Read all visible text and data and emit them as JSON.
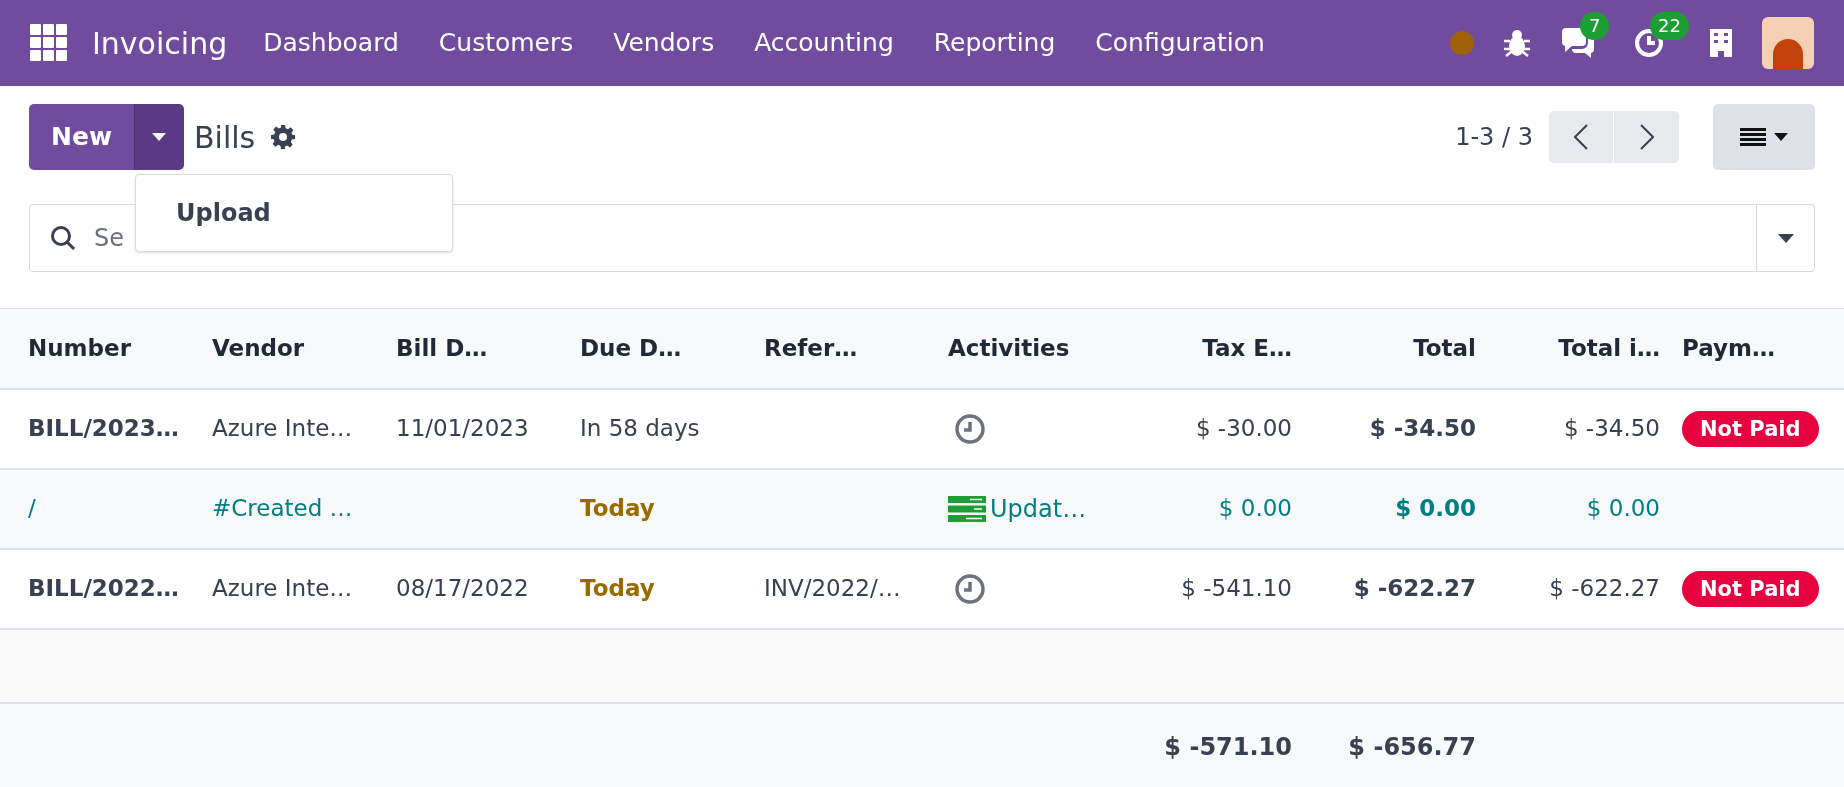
{
  "navbar": {
    "app_name": "Invoicing",
    "menu": [
      "Dashboard",
      "Customers",
      "Vendors",
      "Accounting",
      "Reporting",
      "Configuration"
    ],
    "messages_count": "7",
    "activities_count": "22"
  },
  "control_panel": {
    "new_button": "New",
    "title": "Bills",
    "pager": "1-3 / 3",
    "dropdown": {
      "expanded": true,
      "items": [
        "Upload"
      ]
    },
    "search": {
      "placeholder": "Se"
    }
  },
  "table": {
    "columns": [
      "Number",
      "Vendor",
      "Bill D…",
      "Due D…",
      "Refer…",
      "Activities",
      "Tax E…",
      "Total",
      "Total i…",
      "Paym…"
    ],
    "rows": [
      {
        "draft": false,
        "number": "BILL/2023…",
        "vendor": "Azure Inte…",
        "bill_date": "11/01/2023",
        "due_date": "In 58 days",
        "due_today": false,
        "reference": "",
        "activity": {
          "kind": "clock"
        },
        "tax_excluded": "$ -30.00",
        "total": "$ -34.50",
        "total_in_currency": "$ -34.50",
        "payment": "Not Paid"
      },
      {
        "draft": true,
        "number": "/",
        "vendor": "#Created …",
        "bill_date": "",
        "due_date": "Today",
        "due_today": true,
        "reference": "",
        "activity": {
          "kind": "todo",
          "label": "Updat…"
        },
        "tax_excluded": "$ 0.00",
        "total": "$ 0.00",
        "total_in_currency": "$ 0.00"
      },
      {
        "draft": false,
        "number": "BILL/2022…",
        "vendor": "Azure Inte…",
        "bill_date": "08/17/2022",
        "due_date": "Today",
        "due_today": true,
        "reference": "INV/2022/…",
        "activity": {
          "kind": "clock"
        },
        "tax_excluded": "$ -541.10",
        "total": "$ -622.27",
        "total_in_currency": "$ -622.27",
        "payment": "Not Paid"
      }
    ],
    "totals": {
      "tax_excluded": "$ -571.10",
      "total": "$ -656.77"
    }
  }
}
